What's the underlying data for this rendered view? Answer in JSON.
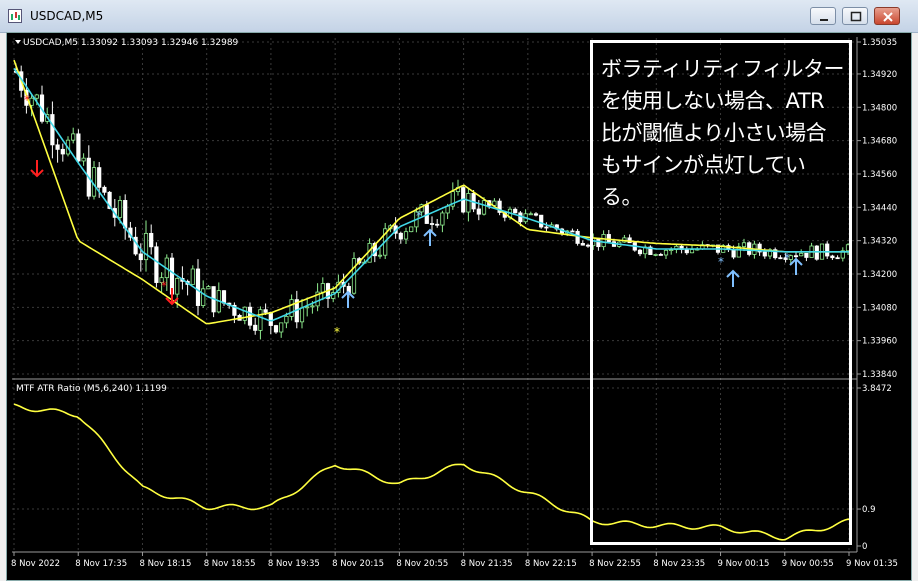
{
  "window": {
    "title": "USDCAD,M5",
    "buttons": [
      "minimize",
      "maximize",
      "close"
    ]
  },
  "main_chart": {
    "header": "USDCAD,M5  1.33092 1.33093 1.32946 1.32989",
    "y_ticks": [
      "1.35035",
      "1.34920",
      "1.34800",
      "1.34680",
      "1.34560",
      "1.34440",
      "1.34320",
      "1.34200",
      "1.34080",
      "1.33960",
      "1.33840"
    ]
  },
  "indicator": {
    "header": "MTF ATR Ratio  (M5,6,240) 1.1199",
    "y_ticks": [
      "3.8472",
      "0.9",
      "0"
    ]
  },
  "x_ticks": [
    "8 Nov 2022",
    "8 Nov 17:35",
    "8 Nov 18:15",
    "8 Nov 18:55",
    "8 Nov 19:35",
    "8 Nov 20:15",
    "8 Nov 20:55",
    "8 Nov 21:35",
    "8 Nov 22:15",
    "8 Nov 22:55",
    "8 Nov 23:35",
    "9 Nov 00:15",
    "9 Nov 00:55",
    "9 Nov 01:35"
  ],
  "annotation": {
    "lines": [
      "ボラティリティフィルター",
      "を使用しない場合、ATR",
      "比が閾値より小さい場合",
      "もサインが点灯してい",
      "る。"
    ]
  },
  "colors": {
    "background": "#000000",
    "bull_candle": "#90ee90",
    "bear_candle": "#ffffff",
    "fast_ma": "#40d8e8",
    "slow_ma": "#ffff40",
    "sell_arrow": "#ff2020",
    "buy_arrow": "#80c0ff"
  },
  "chart_data": {
    "type": "line",
    "x": [
      "8 Nov 2022",
      "8 Nov 17:35",
      "8 Nov 18:15",
      "8 Nov 18:55",
      "8 Nov 19:35",
      "8 Nov 20:15",
      "8 Nov 20:55",
      "8 Nov 21:35",
      "8 Nov 22:15",
      "8 Nov 22:55",
      "8 Nov 23:35",
      "9 Nov 00:15",
      "9 Nov 00:55",
      "9 Nov 01:35"
    ],
    "series": [
      {
        "values": [
          1.3494,
          1.346,
          1.3428,
          1.3412,
          1.3403,
          1.3413,
          1.3437,
          1.3447,
          1.344,
          1.3432,
          1.3429,
          1.3429,
          1.3428,
          1.3428
        ]
      },
      {
        "values": [
          1.3497,
          1.3432,
          1.3418,
          1.3402,
          1.3406,
          1.3415,
          1.344,
          1.3452,
          1.3436,
          1.3433,
          1.3431,
          1.343,
          1.3428,
          1.3428
        ]
      },
      {
        "values": [
          3.4,
          3.2,
          1.4,
          0.95,
          0.95,
          2.0,
          1.5,
          2.0,
          1.3,
          0.6,
          0.5,
          0.45,
          0.2,
          0.6
        ]
      }
    ],
    "ylim_main": [
      1.3384,
      1.35035
    ],
    "ylim_indicator": [
      0,
      3.8472
    ],
    "grid": true
  }
}
